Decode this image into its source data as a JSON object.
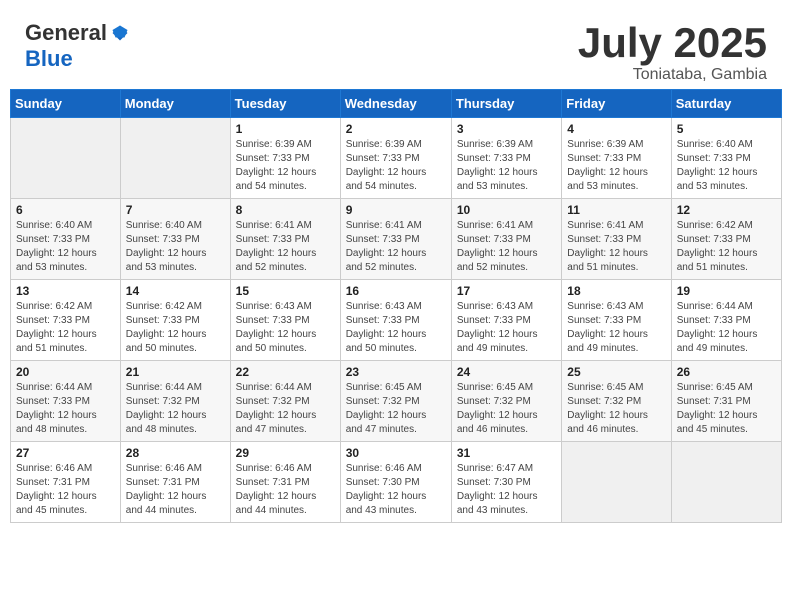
{
  "logo": {
    "general": "General",
    "blue": "Blue"
  },
  "header": {
    "month": "July 2025",
    "location": "Toniataba, Gambia"
  },
  "weekdays": [
    "Sunday",
    "Monday",
    "Tuesday",
    "Wednesday",
    "Thursday",
    "Friday",
    "Saturday"
  ],
  "weeks": [
    [
      {
        "day": "",
        "info": ""
      },
      {
        "day": "",
        "info": ""
      },
      {
        "day": "1",
        "sunrise": "6:39 AM",
        "sunset": "7:33 PM",
        "daylight": "12 hours and 54 minutes."
      },
      {
        "day": "2",
        "sunrise": "6:39 AM",
        "sunset": "7:33 PM",
        "daylight": "12 hours and 54 minutes."
      },
      {
        "day": "3",
        "sunrise": "6:39 AM",
        "sunset": "7:33 PM",
        "daylight": "12 hours and 53 minutes."
      },
      {
        "day": "4",
        "sunrise": "6:39 AM",
        "sunset": "7:33 PM",
        "daylight": "12 hours and 53 minutes."
      },
      {
        "day": "5",
        "sunrise": "6:40 AM",
        "sunset": "7:33 PM",
        "daylight": "12 hours and 53 minutes."
      }
    ],
    [
      {
        "day": "6",
        "sunrise": "6:40 AM",
        "sunset": "7:33 PM",
        "daylight": "12 hours and 53 minutes."
      },
      {
        "day": "7",
        "sunrise": "6:40 AM",
        "sunset": "7:33 PM",
        "daylight": "12 hours and 53 minutes."
      },
      {
        "day": "8",
        "sunrise": "6:41 AM",
        "sunset": "7:33 PM",
        "daylight": "12 hours and 52 minutes."
      },
      {
        "day": "9",
        "sunrise": "6:41 AM",
        "sunset": "7:33 PM",
        "daylight": "12 hours and 52 minutes."
      },
      {
        "day": "10",
        "sunrise": "6:41 AM",
        "sunset": "7:33 PM",
        "daylight": "12 hours and 52 minutes."
      },
      {
        "day": "11",
        "sunrise": "6:41 AM",
        "sunset": "7:33 PM",
        "daylight": "12 hours and 51 minutes."
      },
      {
        "day": "12",
        "sunrise": "6:42 AM",
        "sunset": "7:33 PM",
        "daylight": "12 hours and 51 minutes."
      }
    ],
    [
      {
        "day": "13",
        "sunrise": "6:42 AM",
        "sunset": "7:33 PM",
        "daylight": "12 hours and 51 minutes."
      },
      {
        "day": "14",
        "sunrise": "6:42 AM",
        "sunset": "7:33 PM",
        "daylight": "12 hours and 50 minutes."
      },
      {
        "day": "15",
        "sunrise": "6:43 AM",
        "sunset": "7:33 PM",
        "daylight": "12 hours and 50 minutes."
      },
      {
        "day": "16",
        "sunrise": "6:43 AM",
        "sunset": "7:33 PM",
        "daylight": "12 hours and 50 minutes."
      },
      {
        "day": "17",
        "sunrise": "6:43 AM",
        "sunset": "7:33 PM",
        "daylight": "12 hours and 49 minutes."
      },
      {
        "day": "18",
        "sunrise": "6:43 AM",
        "sunset": "7:33 PM",
        "daylight": "12 hours and 49 minutes."
      },
      {
        "day": "19",
        "sunrise": "6:44 AM",
        "sunset": "7:33 PM",
        "daylight": "12 hours and 49 minutes."
      }
    ],
    [
      {
        "day": "20",
        "sunrise": "6:44 AM",
        "sunset": "7:33 PM",
        "daylight": "12 hours and 48 minutes."
      },
      {
        "day": "21",
        "sunrise": "6:44 AM",
        "sunset": "7:32 PM",
        "daylight": "12 hours and 48 minutes."
      },
      {
        "day": "22",
        "sunrise": "6:44 AM",
        "sunset": "7:32 PM",
        "daylight": "12 hours and 47 minutes."
      },
      {
        "day": "23",
        "sunrise": "6:45 AM",
        "sunset": "7:32 PM",
        "daylight": "12 hours and 47 minutes."
      },
      {
        "day": "24",
        "sunrise": "6:45 AM",
        "sunset": "7:32 PM",
        "daylight": "12 hours and 46 minutes."
      },
      {
        "day": "25",
        "sunrise": "6:45 AM",
        "sunset": "7:32 PM",
        "daylight": "12 hours and 46 minutes."
      },
      {
        "day": "26",
        "sunrise": "6:45 AM",
        "sunset": "7:31 PM",
        "daylight": "12 hours and 45 minutes."
      }
    ],
    [
      {
        "day": "27",
        "sunrise": "6:46 AM",
        "sunset": "7:31 PM",
        "daylight": "12 hours and 45 minutes."
      },
      {
        "day": "28",
        "sunrise": "6:46 AM",
        "sunset": "7:31 PM",
        "daylight": "12 hours and 44 minutes."
      },
      {
        "day": "29",
        "sunrise": "6:46 AM",
        "sunset": "7:31 PM",
        "daylight": "12 hours and 44 minutes."
      },
      {
        "day": "30",
        "sunrise": "6:46 AM",
        "sunset": "7:30 PM",
        "daylight": "12 hours and 43 minutes."
      },
      {
        "day": "31",
        "sunrise": "6:47 AM",
        "sunset": "7:30 PM",
        "daylight": "12 hours and 43 minutes."
      },
      {
        "day": "",
        "info": ""
      },
      {
        "day": "",
        "info": ""
      }
    ]
  ],
  "labels": {
    "sunrise": "Sunrise:",
    "sunset": "Sunset:",
    "daylight": "Daylight:"
  }
}
